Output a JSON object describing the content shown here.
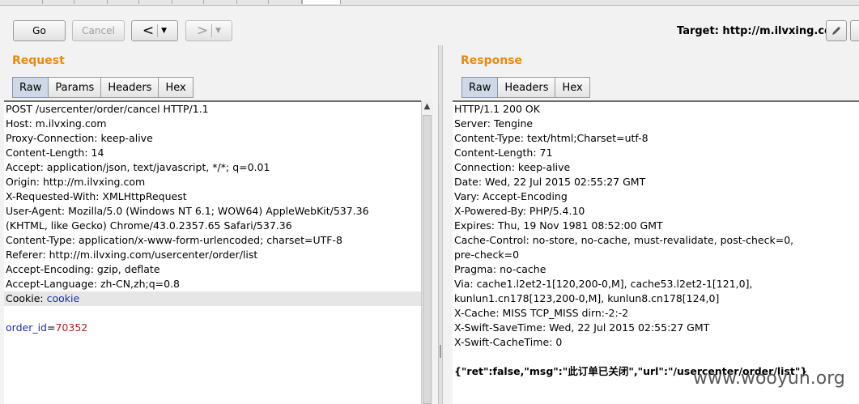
{
  "toolbar": {
    "go_label": "Go",
    "cancel_label": "Cancel",
    "back_arrow": "<",
    "forward_arrow": ">",
    "dropdown_glyph": "▼",
    "target_label": "Target: http://m.ilvxing.com"
  },
  "request": {
    "title": "Request",
    "tabs": [
      "Raw",
      "Params",
      "Headers",
      "Hex"
    ],
    "active_tab": "Raw",
    "lines": [
      "POST /usercenter/order/cancel HTTP/1.1",
      "Host: m.ilvxing.com",
      "Proxy-Connection: keep-alive",
      "Content-Length: 14",
      "Accept: application/json, text/javascript, */*; q=0.01",
      "Origin: http://m.ilvxing.com",
      "X-Requested-With: XMLHttpRequest",
      "User-Agent: Mozilla/5.0 (Windows NT 6.1; WOW64) AppleWebKit/537.36",
      "(KHTML, like Gecko) Chrome/43.0.2357.65 Safari/537.36",
      "Content-Type: application/x-www-form-urlencoded; charset=UTF-8",
      "Referer: http://m.ilvxing.com/usercenter/order/list",
      "Accept-Encoding: gzip, deflate",
      "Accept-Language: zh-CN,zh;q=0.8"
    ],
    "cookie_name": "Cookie: ",
    "cookie_value": "cookie",
    "body_param": "order_id",
    "body_eq": "=",
    "body_value": "70352"
  },
  "response": {
    "title": "Response",
    "tabs": [
      "Raw",
      "Headers",
      "Hex"
    ],
    "active_tab": "Raw",
    "lines": [
      "HTTP/1.1 200 OK",
      "Server: Tengine",
      "Content-Type: text/html;Charset=utf-8",
      "Content-Length: 71",
      "Connection: keep-alive",
      "Date: Wed, 22 Jul 2015 02:55:27 GMT",
      "Vary: Accept-Encoding",
      "X-Powered-By: PHP/5.4.10",
      "Expires: Thu, 19 Nov 1981 08:52:00 GMT",
      "Cache-Control: no-store, no-cache, must-revalidate, post-check=0,",
      "pre-check=0",
      "Pragma: no-cache",
      "Via: cache1.l2et2-1[120,200-0,M], cache53.l2et2-1[121,0],",
      "kunlun1.cn178[123,200-0,M], kunlun8.cn178[124,0]",
      "X-Cache: MISS TCP_MISS dirn:-2:-2",
      "X-Swift-SaveTime: Wed, 22 Jul 2015 02:55:27 GMT",
      "X-Swift-CacheTime: 0"
    ],
    "body": "{\"ret\":false,\"msg\":\"此订单已关闭\",\"url\":\"/usercenter/order/list\"}"
  },
  "watermark": "www.wooyun.org",
  "colors": {
    "section_title": "#e58a13",
    "active_tab": "#cfd8e6",
    "param_blue": "#1d2fa6",
    "value_red": "#a5221b"
  }
}
